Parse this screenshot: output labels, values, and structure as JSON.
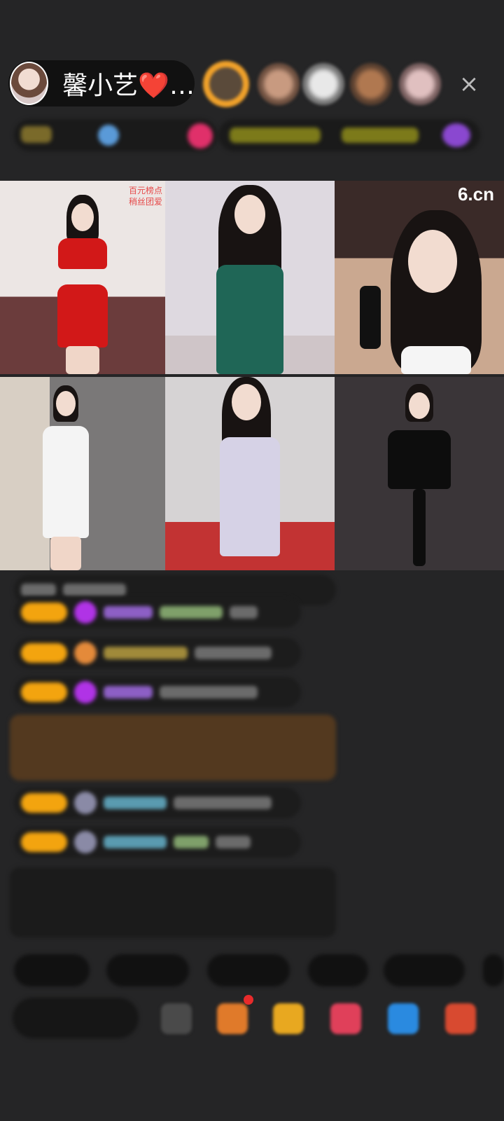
{
  "anchor": {
    "name": "馨小艺❤️…"
  },
  "header": {
    "close_icon": "×"
  },
  "video_grid": {
    "cell1": {
      "overlay_line1": "百元榜点",
      "overlay_line2": "稍丝团爱"
    },
    "cell3": {
      "logo": "6.cn"
    }
  },
  "colors": {
    "background": "#252526",
    "level_badge": "#f3a40f",
    "system_message": "#53391f"
  }
}
